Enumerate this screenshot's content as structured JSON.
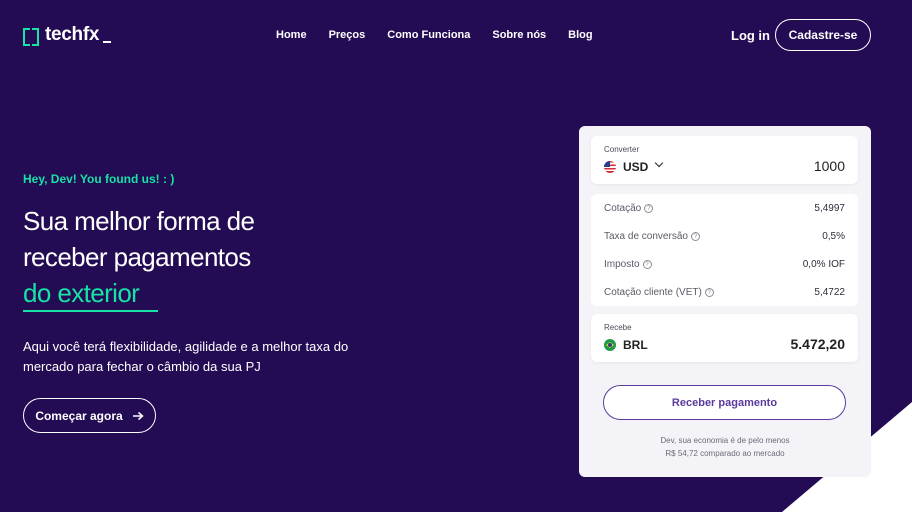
{
  "header": {
    "logo_text": "techfx",
    "nav": [
      "Home",
      "Preços",
      "Como Funciona",
      "Sobre nós",
      "Blog"
    ],
    "login_label": "Log in",
    "signup_label": "Cadastre-se"
  },
  "hero": {
    "eyebrow": "Hey, Dev! You found us! : )",
    "headline_line1": "Sua melhor forma de",
    "headline_line2": "receber pagamentos",
    "headline_accent": "do exterior",
    "description": "Aqui você terá flexibilidade, agilidade e a melhor taxa do mercado para fechar o câmbio da sua PJ",
    "cta_label": "Começar agora",
    "cta_icon": "arrow-right-icon"
  },
  "converter": {
    "from_label": "Converter",
    "from_currency": "USD",
    "from_amount": "1000",
    "rows": [
      {
        "label": "Cotação",
        "value": "5,4997"
      },
      {
        "label": "Taxa de conversão",
        "value": "0,5%"
      },
      {
        "label": "Imposto",
        "value": "0,0% IOF"
      },
      {
        "label": "Cotação cliente (VET)",
        "value": "5,4722"
      }
    ],
    "to_label": "Recebe",
    "to_currency": "BRL",
    "to_amount": "5.472,20",
    "button_label": "Receber pagamento",
    "savings_line1": "Dev, sua economia é de pelo menos",
    "savings_line2": "R$ 54,72 comparado ao mercado"
  },
  "colors": {
    "background": "#230c54",
    "accent": "#18e2a5",
    "button_purple": "#5b3a9e"
  }
}
